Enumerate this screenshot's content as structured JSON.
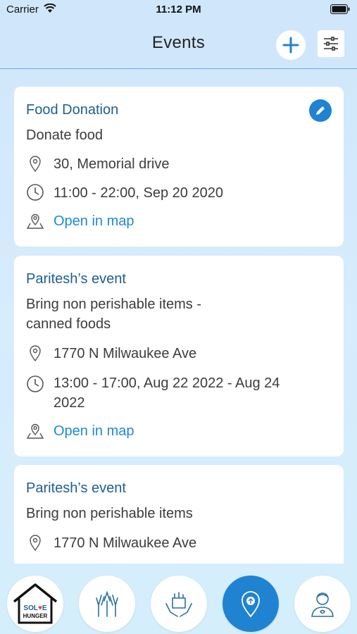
{
  "status_bar": {
    "carrier": "Carrier",
    "time": "11:12 PM"
  },
  "header": {
    "title": "Events",
    "add_icon": "plus-icon",
    "filter_icon": "sliders-icon"
  },
  "colors": {
    "accent": "#1f83d1",
    "title_blue": "#1f5e8f",
    "link_blue": "#1e8ad1"
  },
  "events": [
    {
      "title": "Food Donation",
      "description": "Donate food",
      "address": "30, Memorial drive",
      "time": "11:00 - 22:00, Sep 20 2020",
      "map_link": "Open in map",
      "editable": true
    },
    {
      "title": "Paritesh’s event",
      "description": "Bring non perishable items - canned foods",
      "address": "1770 N Milwaukee Ave",
      "time": "13:00 - 17:00, Aug 22 2022 - Aug 24 2022",
      "map_link": "Open in map",
      "editable": false
    },
    {
      "title": "Paritesh’s event",
      "description": "Bring non perishable items",
      "address": "1770 N Milwaukee Ave"
    }
  ],
  "tabbar": {
    "logo_text": "SOLVE HUNGER",
    "items": [
      "home-logo-icon",
      "volunteer-hands-icon",
      "donation-box-icon",
      "location-pin-icon",
      "profile-icon"
    ],
    "active_index": 3
  }
}
